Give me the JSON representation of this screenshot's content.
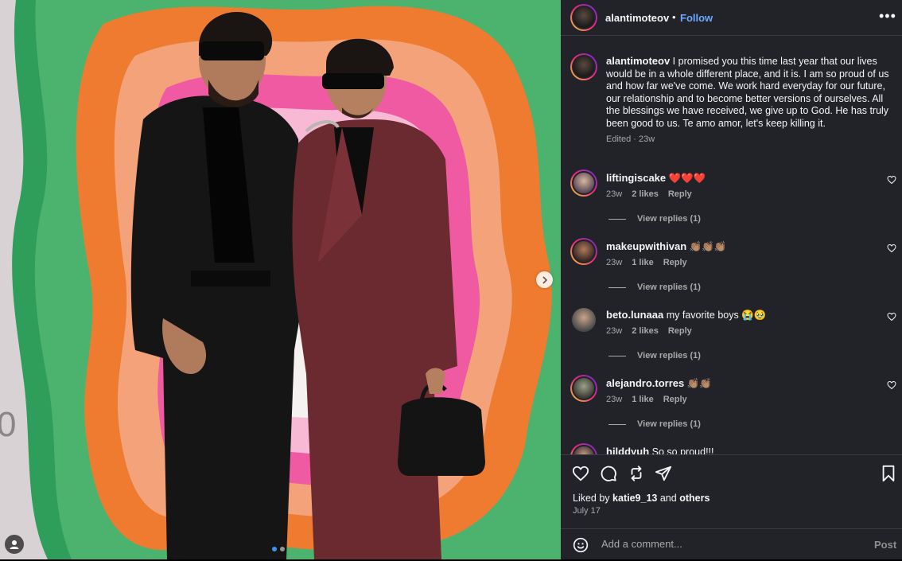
{
  "post": {
    "author": "alantimoteov",
    "separator": "•",
    "follow_label": "Follow",
    "more_label": "•••",
    "caption": "I promised you this time last year that our lives would be in a whole different place, and it is. I am so proud of us and how far we've come. We work hard everyday for our future, our relationship and to become better versions of ourselves. All the blessings we have received, we give up to God. He has truly been good to us. Te amo amor, let's keep killing it.",
    "caption_meta": "Edited · 23w",
    "carousel": {
      "current": 1,
      "total": 2
    }
  },
  "comments": [
    {
      "user": "liftingiscake",
      "text": "❤️❤️❤️",
      "time": "23w",
      "likes": "2 likes",
      "reply": "Reply",
      "replies": "View replies (1)"
    },
    {
      "user": "makeupwithivan",
      "text": "👏🏽👏🏽👏🏽",
      "time": "23w",
      "likes": "1 like",
      "reply": "Reply",
      "replies": "View replies (1)"
    },
    {
      "user": "beto.lunaaa",
      "text": "my favorite boys 😭🥹",
      "time": "23w",
      "likes": "2 likes",
      "reply": "Reply",
      "replies": "View replies (1)"
    },
    {
      "user": "alejandro.torres",
      "text": "👏🏽👏🏽",
      "time": "23w",
      "likes": "1 like",
      "reply": "Reply",
      "replies": "View replies (1)"
    },
    {
      "user": "hilddyuh",
      "text": "So so proud!!!",
      "time": "",
      "likes": "",
      "reply": "",
      "replies": ""
    }
  ],
  "actions": {
    "liked_by_prefix": "Liked by",
    "liked_by_user": "katie9_13",
    "liked_by_and": "and",
    "liked_by_others": "others",
    "date": "July 17"
  },
  "composer": {
    "placeholder": "Add a comment...",
    "post_label": "Post"
  },
  "icons": {
    "like": "heart-icon",
    "comment": "comment-bubble-icon",
    "share": "repost-icon",
    "send": "paper-plane-icon",
    "save": "bookmark-icon",
    "emoji": "smiley-icon",
    "next": "chevron-right-icon",
    "tags": "user-tag-icon"
  },
  "colors": {
    "panel_bg": "#212328",
    "follow": "#6aa9ff",
    "heart_emoji": "#e0245e"
  }
}
